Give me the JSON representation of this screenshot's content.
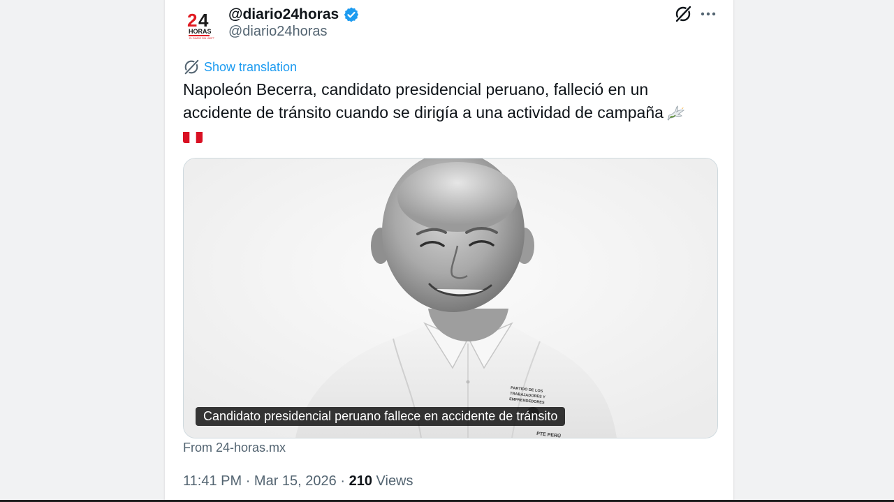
{
  "account": {
    "display_name": "@diario24horas",
    "handle": "@diario24horas",
    "verified": true,
    "avatar_logo": {
      "number": "24",
      "word": "HORAS",
      "tagline": "EL DIARIO SIN LÍMITES"
    }
  },
  "actions": {
    "grok_icon": "grok-icon",
    "more_icon": "more-icon"
  },
  "translation": {
    "label": "Show translation"
  },
  "tweet": {
    "text": "Napoleón Becerra, candidato presidencial peruano, falleció en un accidente de tránsito cuando se dirigía a una actividad de campaña",
    "emoji_dove": "dove-emoji",
    "emoji_flag": "peru-flag-emoji"
  },
  "media": {
    "caption": "Candidato presidencial peruano fallece en accidente de tránsito",
    "shirt_text": "PARTIDO DE LOS TRABAJADORES Y EMPRENDEDORES",
    "badge_text": "PTE PERÚ"
  },
  "link_source": "From 24-horas.mx",
  "meta": {
    "time": "11:41 PM",
    "separator": "·",
    "date": "Mar 15, 2026",
    "views_count": "210",
    "views_label": "Views"
  },
  "colors": {
    "accent": "#1d9bf0",
    "text_primary": "#0f1419",
    "text_secondary": "#536471",
    "verified": "#1d9bf0",
    "logo_red": "#e01b22"
  }
}
